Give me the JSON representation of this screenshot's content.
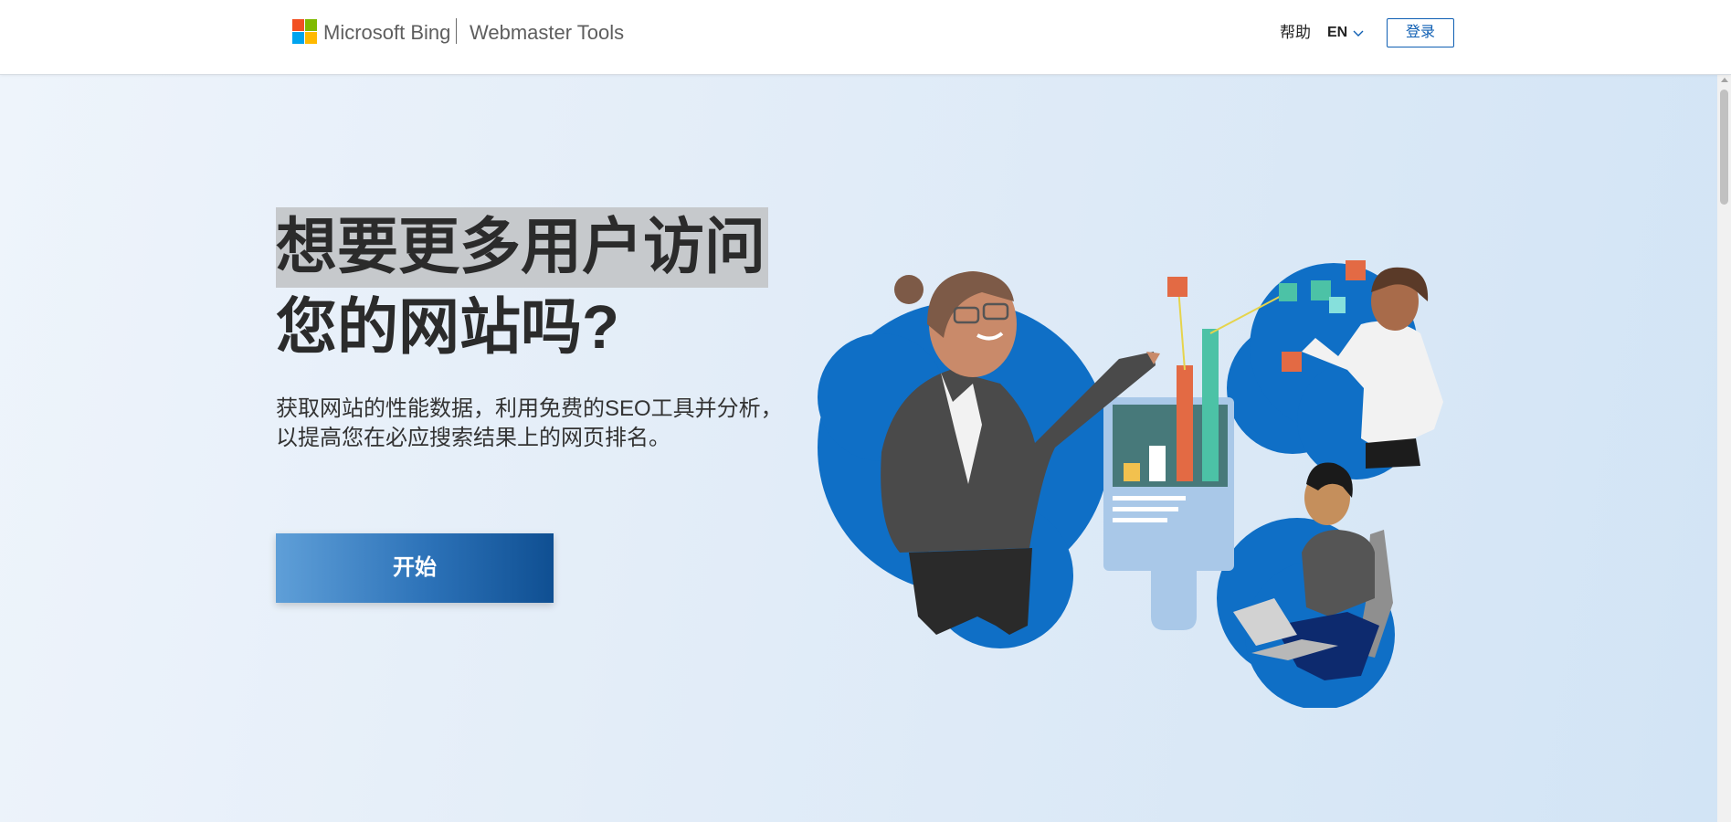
{
  "header": {
    "brand": "Microsoft Bing",
    "product": "Webmaster Tools",
    "help_label": "帮助",
    "language_label": "EN",
    "login_label": "登录"
  },
  "hero": {
    "headline_line1": "想要更多用户访问",
    "headline_line2": "您的网站吗?",
    "subtext_line1": "获取网站的性能数据，利用免费的SEO工具并分析，",
    "subtext_line2": "以提高您在必应搜索结果上的网页排名。",
    "cta_label": "开始"
  },
  "icons": [
    "microsoft-logo-icon",
    "chevron-down-icon",
    "analytics-team-illustration"
  ],
  "colors": {
    "accent": "#0f5fb3",
    "logo_red": "#f25022",
    "logo_green": "#7fba00",
    "logo_blue": "#00a4ef",
    "logo_yellow": "#ffb900",
    "cta_start": "#5f9fd8",
    "cta_end": "#0f4f92"
  }
}
